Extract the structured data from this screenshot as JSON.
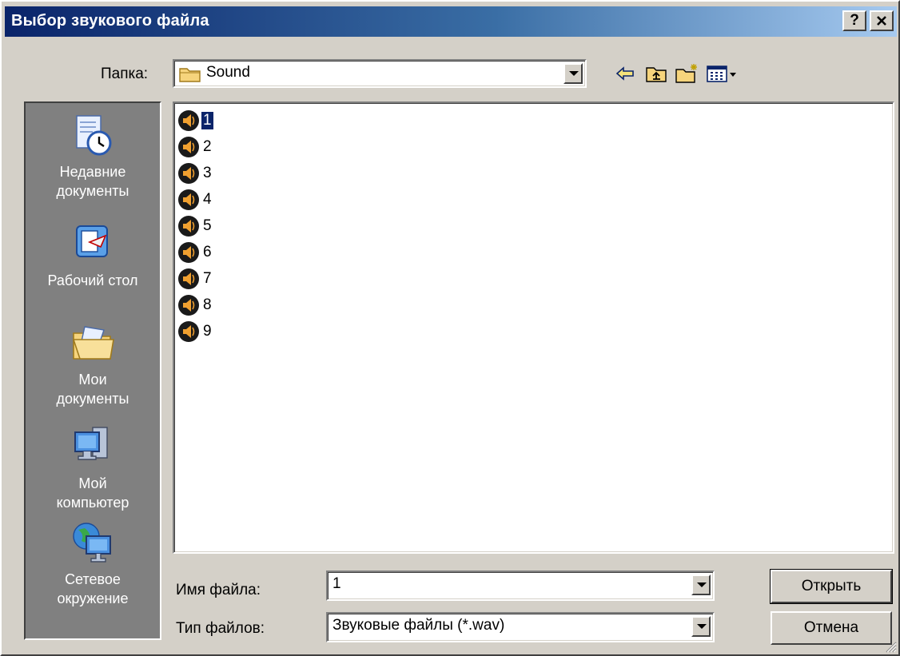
{
  "window": {
    "title": "Выбор звукового файла",
    "help_glyph": "?",
    "close_glyph": "✕"
  },
  "toolbar": {
    "folder_label": "Папка:",
    "folder_value": "Sound"
  },
  "places": [
    {
      "label_line1": "Недавние",
      "label_line2": "документы",
      "icon": "recent-documents-icon"
    },
    {
      "label_line1": "Рабочий стол",
      "label_line2": "",
      "icon": "desktop-icon"
    },
    {
      "label_line1": "Мои",
      "label_line2": "документы",
      "icon": "my-documents-icon"
    },
    {
      "label_line1": "Мой",
      "label_line2": "компьютер",
      "icon": "my-computer-icon"
    },
    {
      "label_line1": "Сетевое",
      "label_line2": "окружение",
      "icon": "network-icon"
    }
  ],
  "files": [
    "1",
    "2",
    "3",
    "4",
    "5",
    "6",
    "7",
    "8",
    "9"
  ],
  "selected_file": "1",
  "form": {
    "filename_label": "Имя файла:",
    "filename_value": "1",
    "filetype_label": "Тип файлов:",
    "filetype_value": "Звуковые файлы (*.wav)"
  },
  "buttons": {
    "open": "Открыть",
    "cancel": "Отмена"
  },
  "colors": {
    "titlebar_start": "#0a246a",
    "titlebar_end": "#a6caf0",
    "face": "#d4d0c8",
    "places_bg": "#808080",
    "selection": "#0a246a"
  }
}
